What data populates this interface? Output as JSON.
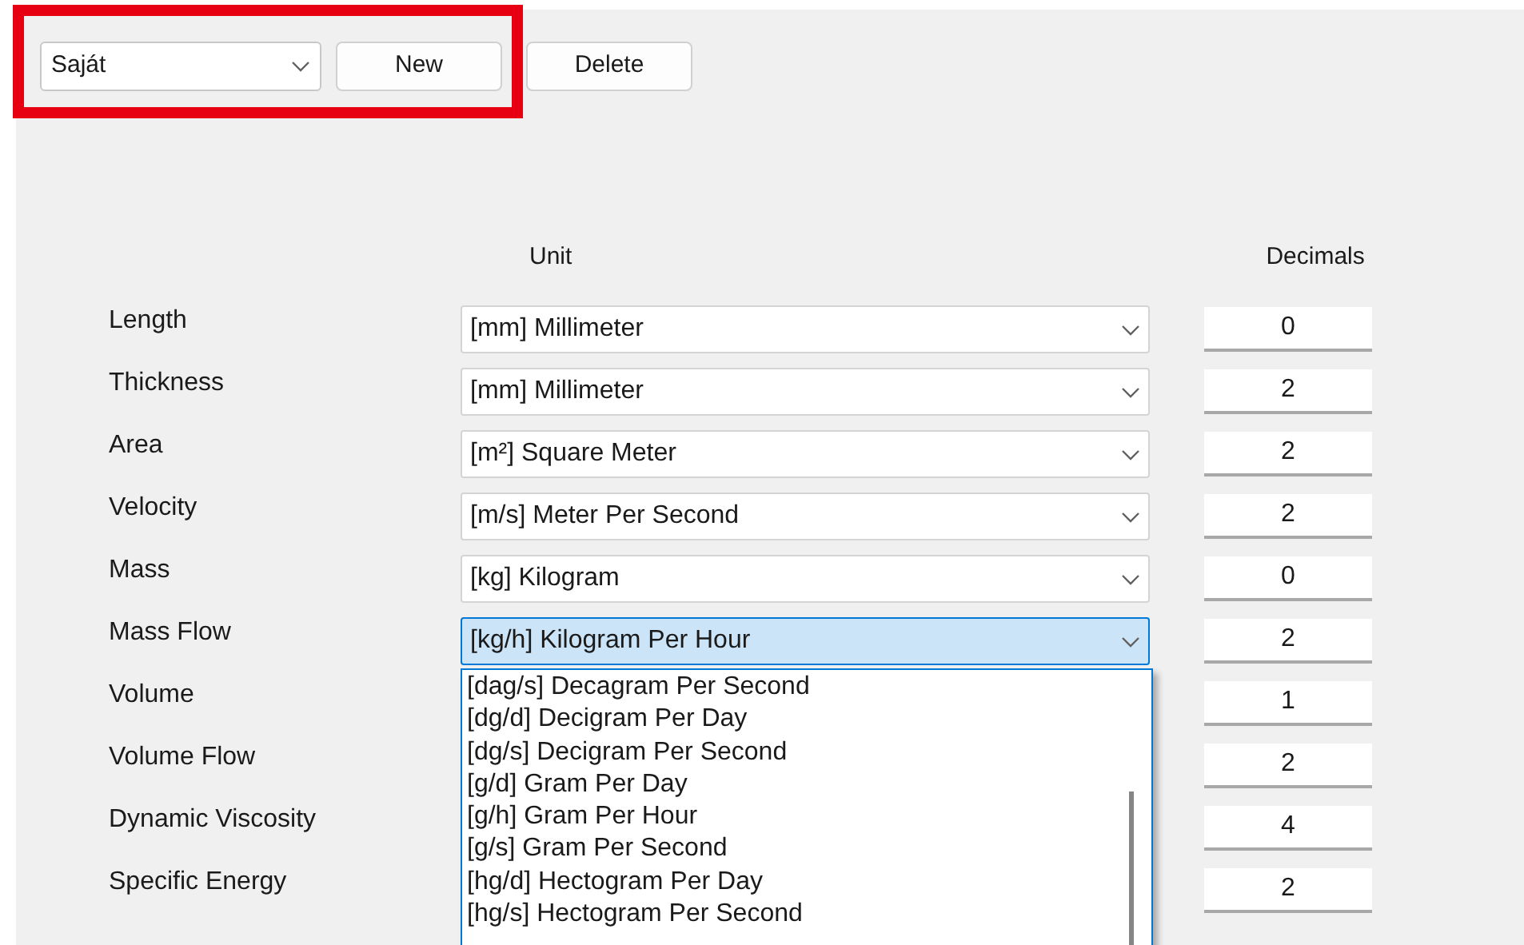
{
  "toolbar": {
    "profile": "Saját",
    "buttons": [
      "New",
      "Delete"
    ],
    "highlighted": true
  },
  "headers": {
    "unit": "Unit",
    "decimals": "Decimals"
  },
  "rows": [
    {
      "label": "Length",
      "unit": "[mm] Millimeter",
      "decimals": "0",
      "expanded": false
    },
    {
      "label": "Thickness",
      "unit": "[mm] Millimeter",
      "decimals": "2",
      "expanded": false
    },
    {
      "label": "Area",
      "unit": "[m²] Square Meter",
      "decimals": "2",
      "expanded": false
    },
    {
      "label": "Velocity",
      "unit": "[m/s] Meter Per Second",
      "decimals": "2",
      "expanded": false
    },
    {
      "label": "Mass",
      "unit": "[kg] Kilogram",
      "decimals": "0",
      "expanded": false
    },
    {
      "label": "Mass Flow",
      "unit": "[kg/h] Kilogram Per Hour",
      "decimals": "2",
      "expanded": true,
      "options": [
        "[dag/s] Decagram Per Second",
        "[dg/d] Decigram Per Day",
        "[dg/s] Decigram Per Second",
        "[g/d] Gram Per Day",
        "[g/h] Gram Per Hour",
        "[g/s] Gram Per Second",
        "[hg/d] Hectogram Per Day",
        "[hg/s] Hectogram Per Second"
      ]
    },
    {
      "label": "Volume",
      "decimals": "1"
    },
    {
      "label": "Volume Flow",
      "decimals": "2"
    },
    {
      "label": "Dynamic Viscosity",
      "decimals": "4"
    },
    {
      "label": "Specific Energy",
      "decimals": "2"
    }
  ]
}
